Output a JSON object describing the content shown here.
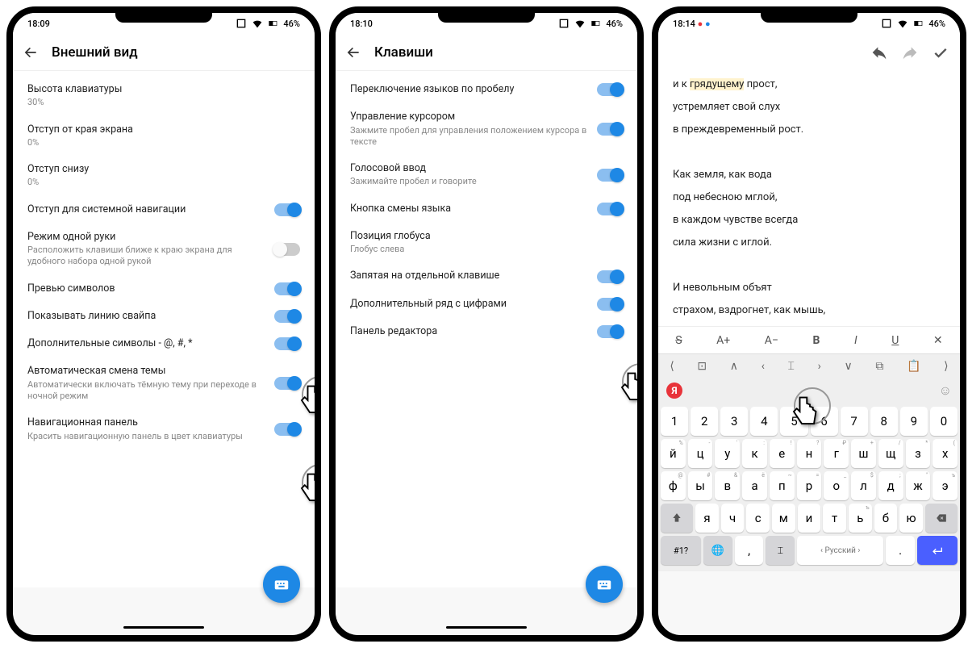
{
  "phone1": {
    "time": "18:09",
    "battery": "46%",
    "title": "Внешний вид",
    "settings": [
      {
        "title": "Высота клавиатуры",
        "sub": "30%",
        "toggle": null
      },
      {
        "title": "Отступ от края экрана",
        "sub": "0%",
        "toggle": null
      },
      {
        "title": "Отступ снизу",
        "sub": "0%",
        "toggle": null
      },
      {
        "title": "Отступ для системной навигации",
        "sub": "",
        "toggle": "on"
      },
      {
        "title": "Режим одной руки",
        "sub": "Расположить клавиши ближе к краю экрана для удобного набора одной рукой",
        "toggle": "off"
      },
      {
        "title": "Превью символов",
        "sub": "",
        "toggle": "on"
      },
      {
        "title": "Показывать линию свайпа",
        "sub": "",
        "toggle": "on"
      },
      {
        "title": "Дополнительные символы - @, #, *",
        "sub": "",
        "toggle": "on"
      },
      {
        "title": "Автоматическая смена темы",
        "sub": "Автоматически включать тёмную тему при переходе в ночной режим",
        "toggle": "on"
      },
      {
        "title": "Навигационная панель",
        "sub": "Красить навигационную панель в цвет клавиатуры",
        "toggle": "on"
      }
    ]
  },
  "phone2": {
    "time": "18:10",
    "battery": "46%",
    "title": "Клавиши",
    "settings": [
      {
        "title": "Переключение языков по пробелу",
        "sub": "",
        "toggle": "on"
      },
      {
        "title": "Управление курсором",
        "sub": "Зажмите пробел для управления положением курсора в тексте",
        "toggle": "on"
      },
      {
        "title": "Голосовой ввод",
        "sub": "Зажимайте пробел и говорите",
        "toggle": "on"
      },
      {
        "title": "Кнопка смены языка",
        "sub": "",
        "toggle": "on"
      },
      {
        "title": "Позиция глобуса",
        "sub": "Глобус слева",
        "toggle": null
      },
      {
        "title": "Запятая на отдельной клавише",
        "sub": "",
        "toggle": "on"
      },
      {
        "title": "Дополнительный ряд с цифрами",
        "sub": "",
        "toggle": "on"
      },
      {
        "title": "Панель редактора",
        "sub": "",
        "toggle": "on"
      }
    ]
  },
  "phone3": {
    "time": "18:14",
    "battery": "46%",
    "lines": [
      "и к грядущему прост,",
      "устремляет свой слух",
      "в преждевременный рост.",
      "",
      "Как земля, как вода",
      "под небесною мглой,",
      "в каждом чувстве всегда",
      "сила жизни с иглой.",
      "",
      "И невольным объят",
      "страхом, вздрогнет, как мышь,"
    ],
    "highlight_word": "грядущему",
    "fmt_labels": {
      "aplus": "A+",
      "aminus": "A−",
      "bold": "B",
      "italic": "I",
      "underline": "U",
      "close": "✕",
      "strike": "S"
    },
    "space_label": "Русский",
    "num_key": "#1?",
    "rows": {
      "nums": [
        "1",
        "2",
        "3",
        "4",
        "5",
        "6",
        "7",
        "8",
        "9",
        "0"
      ],
      "r1": [
        "й",
        "ц",
        "у",
        "к",
        "е",
        "н",
        "г",
        "ш",
        "щ",
        "з",
        "х"
      ],
      "r2": [
        "ф",
        "ы",
        "в",
        "а",
        "п",
        "р",
        "о",
        "л",
        "д",
        "ж",
        "э"
      ],
      "r3": [
        "я",
        "ч",
        "с",
        "м",
        "и",
        "т",
        "ь",
        "б",
        "ю"
      ],
      "sup1": [
        "%",
        "-",
        "'",
        ":",
        "!",
        "?",
        "₽",
        "+",
        "/",
        "*",
        "("
      ],
      "sup2": [
        "@",
        "#",
        "&",
        "ё",
        "~",
        "=",
        "_",
        "$",
        ";",
        "\"",
        "ъ"
      ],
      "sup3": [
        "",
        "",
        "",
        "",
        "",
        "",
        "ъ",
        "",
        ""
      ]
    }
  }
}
